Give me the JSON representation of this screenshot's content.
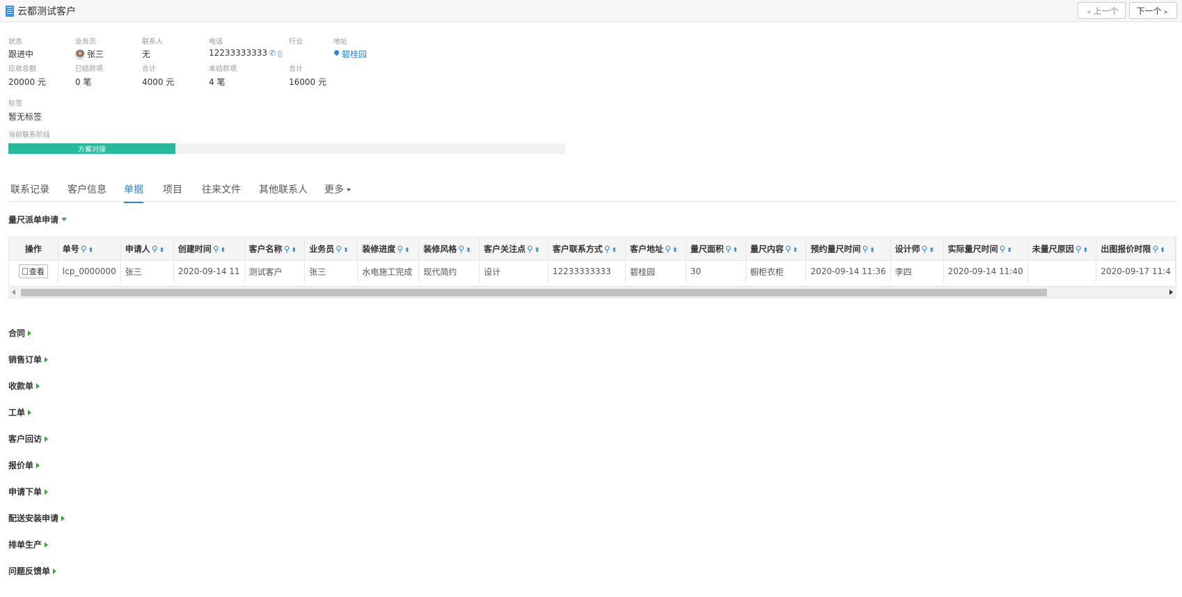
{
  "header": {
    "title": "云都测试客户",
    "prev_label": "﹤上一个",
    "next_label": "下一个﹥"
  },
  "info": {
    "status": {
      "label": "状态",
      "value": "跟进中"
    },
    "salesman": {
      "label": "业务员",
      "value": "张三"
    },
    "contact": {
      "label": "联系人",
      "value": "无"
    },
    "phone": {
      "label": "电话",
      "value": "12233333333"
    },
    "industry": {
      "label": "行业",
      "value": ""
    },
    "address": {
      "label": "地址",
      "value": "碧桂园"
    },
    "receivable": {
      "label": "应收总额",
      "value": "20000 元"
    },
    "settled": {
      "label": "已结款项",
      "value": "0 笔"
    },
    "settled_total": {
      "label": "合计",
      "value": "4000 元"
    },
    "unsettled": {
      "label": "未结款项",
      "value": "4 笔"
    },
    "unsettled_total": {
      "label": "合计",
      "value": "16000 元"
    },
    "tags": {
      "label": "标签",
      "value": "暂无标签"
    },
    "stage": {
      "label": "当前联系阶段",
      "value": "方案对接",
      "progress": 0.3
    }
  },
  "tabs": [
    "联系记录",
    "客户信息",
    "单据",
    "项目",
    "往来文件",
    "其他联系人",
    "更多"
  ],
  "active_tab": "单据",
  "measure_section": {
    "title": "量尺派单申请",
    "columns": [
      "操作",
      "单号",
      "申请人",
      "创建时间",
      "客户名称",
      "业务员",
      "装修进度",
      "装修风格",
      "客户关注点",
      "客户联系方式",
      "客户地址",
      "量尺面积",
      "量尺内容",
      "预约量尺时间",
      "设计师",
      "实际量尺时间",
      "未量尺原因",
      "出图报价时限"
    ],
    "rows": [
      {
        "action": "查看",
        "cells": [
          "lcp_0000000",
          "张三",
          "2020-09-14 11",
          "测试客户",
          "张三",
          "水电施工完成",
          "现代简约",
          "设计",
          "12233333333",
          "碧桂园",
          "30",
          "橱柜衣柜",
          "2020-09-14 11:36",
          "李四",
          "2020-09-14 11:40",
          "",
          "2020-09-17 11:4"
        ]
      }
    ]
  },
  "sections": [
    "合同",
    "销售订单",
    "收款单",
    "工单",
    "客户回访",
    "报价单",
    "申请下单",
    "配送安装申请",
    "排单生产",
    "问题反馈单"
  ]
}
